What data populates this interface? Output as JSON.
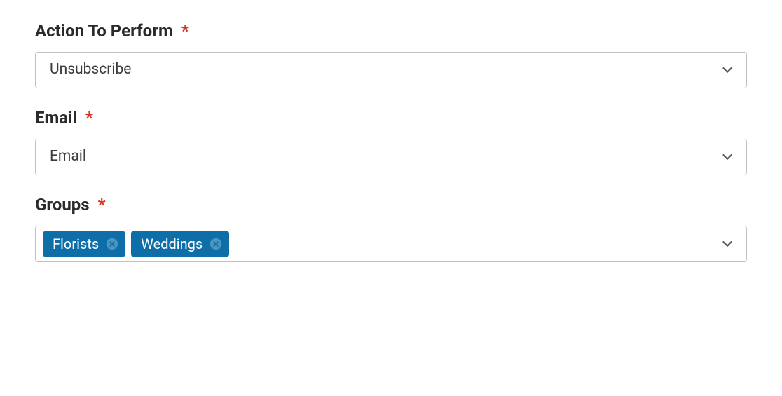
{
  "fields": {
    "action": {
      "label": "Action To Perform",
      "required_mark": "*",
      "value": "Unsubscribe"
    },
    "email": {
      "label": "Email",
      "required_mark": "*",
      "value": "Email"
    },
    "groups": {
      "label": "Groups",
      "required_mark": "*",
      "tags": [
        {
          "name": "Florists"
        },
        {
          "name": "Weddings"
        }
      ]
    }
  }
}
